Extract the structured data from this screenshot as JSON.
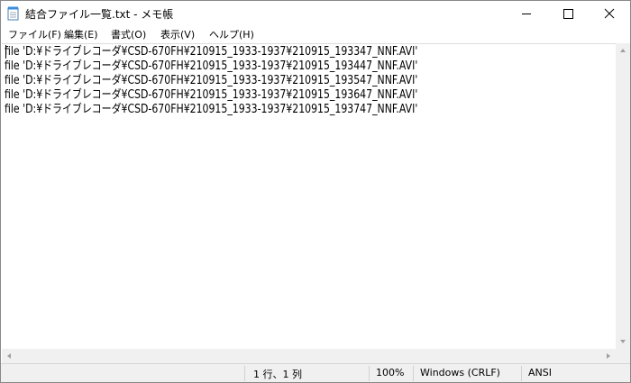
{
  "window": {
    "title": "結合ファイル一覧.txt - メモ帳"
  },
  "icons": {
    "app": "notepad-icon",
    "minimize": "minimize-icon",
    "maximize": "maximize-icon",
    "close": "close-icon"
  },
  "menu": {
    "file": "ファイル(F)",
    "edit": "編集(E)",
    "format": "書式(O)",
    "view": "表示(V)",
    "help": "ヘルプ(H)"
  },
  "editor": {
    "lines": [
      "file 'D:¥ドライブレコーダ¥CSD-670FH¥210915_1933-1937¥210915_193347_NNF.AVI'",
      "file 'D:¥ドライブレコーダ¥CSD-670FH¥210915_1933-1937¥210915_193447_NNF.AVI'",
      "file 'D:¥ドライブレコーダ¥CSD-670FH¥210915_1933-1937¥210915_193547_NNF.AVI'",
      "file 'D:¥ドライブレコーダ¥CSD-670FH¥210915_1933-1937¥210915_193647_NNF.AVI'",
      "file 'D:¥ドライブレコーダ¥CSD-670FH¥210915_1933-1937¥210915_193747_NNF.AVI'"
    ]
  },
  "status": {
    "position": "1 行、1 列",
    "zoom": "100%",
    "line_ending": "Windows (CRLF)",
    "encoding": "ANSI"
  }
}
